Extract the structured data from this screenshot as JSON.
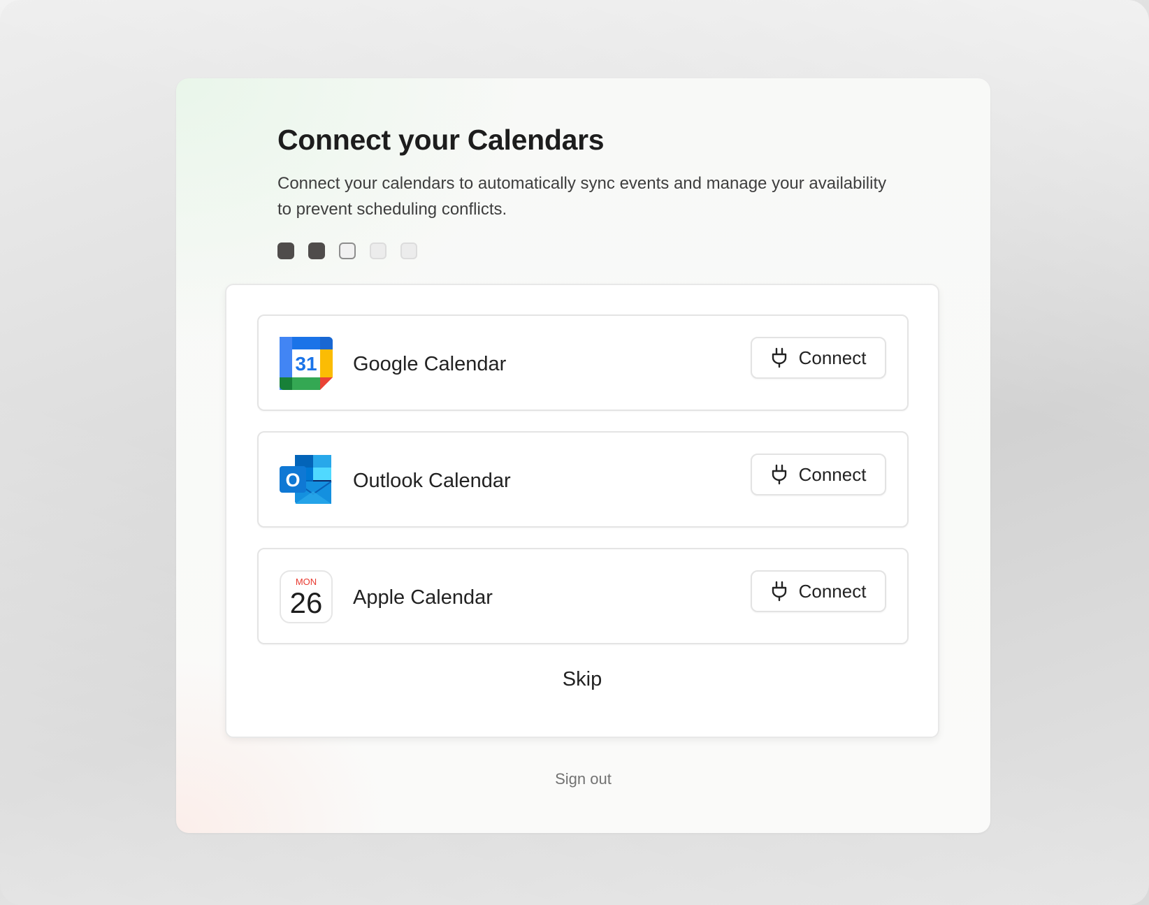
{
  "header": {
    "title": "Connect your Calendars",
    "subtitle": "Connect your calendars to automatically sync events and manage your availability to prevent scheduling conflicts."
  },
  "progress": {
    "steps": [
      "done",
      "done",
      "current",
      "todo",
      "todo"
    ],
    "completed": 2,
    "total": 5
  },
  "calendars": [
    {
      "name": "Google Calendar",
      "icon": "google-calendar-icon",
      "button_label": "Connect",
      "logo_text": "31"
    },
    {
      "name": "Outlook Calendar",
      "icon": "outlook-icon",
      "button_label": "Connect",
      "logo_text": "O"
    },
    {
      "name": "Apple Calendar",
      "icon": "apple-calendar-icon",
      "button_label": "Connect",
      "logo_day": "MON",
      "logo_date": "26"
    }
  ],
  "actions": {
    "skip_label": "Skip",
    "signout_label": "Sign out"
  },
  "colors": {
    "google_blue": "#4285F4",
    "google_green": "#34A853",
    "google_yellow": "#FBBC04",
    "google_red": "#EA4335",
    "outlook_blue": "#0F78D4",
    "apple_red": "#E8392F",
    "step_done": "#4F4C4B"
  }
}
